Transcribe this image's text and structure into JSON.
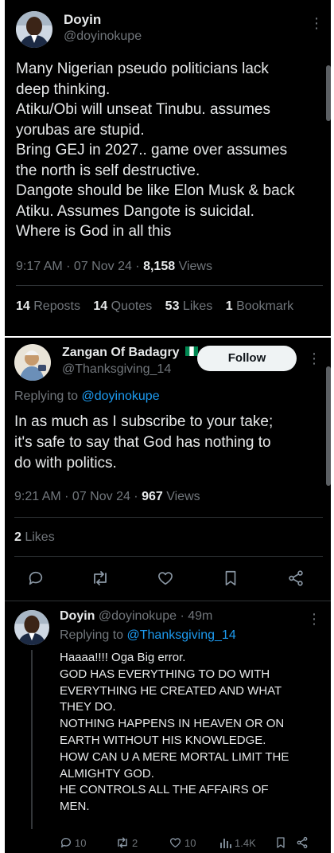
{
  "main_tweet": {
    "name": "Doyin",
    "handle": "@doyinokupe",
    "lines": [
      "Many Nigerian pseudo politicians lack",
      "deep thinking.",
      "Atiku/Obi will unseat Tinubu. assumes",
      "yorubas are stupid.",
      "Bring GEJ in 2027.. game over assumes",
      "the north is self destructive.",
      "Dangote should be like Elon Musk & back",
      "Atiku. Assumes Dangote is suicidal.",
      "Where is God in all this"
    ],
    "time": "9:17 AM · 07 Nov 24 · ",
    "views_count": "8,158",
    "views_label": " Views",
    "stats": {
      "reposts_count": "14",
      "reposts_label": " Reposts",
      "quotes_count": "14",
      "quotes_label": " Quotes",
      "likes_count": "53",
      "likes_label": " Likes",
      "bookmarks_count": "1",
      "bookmarks_label": " Bookmark"
    }
  },
  "reply_tweet": {
    "name": "Zangan Of Badagry",
    "flag_emoji": "nigeria-flag",
    "handle": "@Thanksgiving_14",
    "follow_label": "Follow",
    "replying_prefix": "Replying to ",
    "replying_handle": "@doyinokupe",
    "lines": [
      "In as much as I subscribe to your take;",
      "it's safe to say that God has nothing to",
      "do with politics."
    ],
    "time": "9:21 AM · 07 Nov 24 · ",
    "views_count": "967",
    "views_label": " Views",
    "likes_count": "2",
    "likes_label": " Likes",
    "actions": [
      "reply-icon",
      "retweet-icon",
      "like-icon",
      "bookmark-icon",
      "share-icon"
    ]
  },
  "nested_reply": {
    "name": "Doyin",
    "handle_time": "@doyinokupe · 49m",
    "replying_prefix": "Replying to ",
    "replying_handle": "@Thanksgiving_14",
    "lines": [
      "Haaaa!!!! Oga Big error.",
      "GOD HAS EVERYTHING TO DO WITH",
      "EVERYTHING HE CREATED AND WHAT",
      "THEY DO.",
      "NOTHING HAPPENS IN HEAVEN OR ON",
      "EARTH WITHOUT HIS KNOWLEDGE.",
      "HOW CAN U A MERE MORTAL LIMIT THE",
      "ALMIGHTY GOD.",
      "HE CONTROLS ALL THE AFFAIRS OF",
      "MEN."
    ],
    "actions": {
      "reply_count": "10",
      "retweet_count": "2",
      "like_count": "10",
      "views_count": "1.4K"
    }
  },
  "colors": {
    "background": "#000000",
    "text": "#e7e9ea",
    "secondary": "#71767b",
    "link": "#1d9bf0",
    "divider": "#2f3336"
  }
}
